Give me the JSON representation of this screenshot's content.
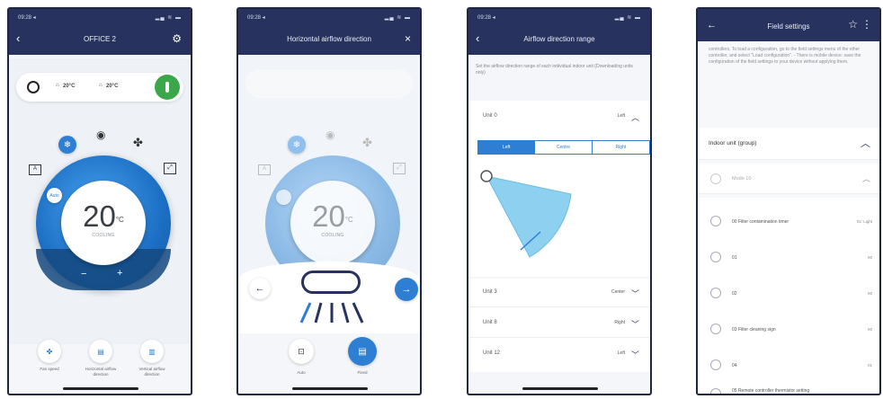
{
  "screen1": {
    "status_time": "09:28 ◂",
    "title": "OFFICE 2",
    "room_temp": "20°C",
    "outdoor_temp": "20°C",
    "set_temp": "20",
    "degree": "°C",
    "mode": "COOLING",
    "minus": "−",
    "plus": "+",
    "btn1_label": "Fan speed",
    "btn2_label": "Horizontal airflow direction",
    "btn3_label": "Vertical airflow direction",
    "fan_badge": "Auto"
  },
  "screen2": {
    "status_time": "09:28 ◂",
    "title": "Horizontal airflow direction",
    "close": "×",
    "set_temp": "20",
    "degree": "°C",
    "mode": "COOLING",
    "auto_label": "Auto",
    "fixed_label": "Fixed"
  },
  "screen3": {
    "status_time": "09:28 ◂",
    "title": "Airflow direction range",
    "description": "Set the airflow direction range of each individual indoor unit (Downloading units only)",
    "units": [
      {
        "name": "Unit 0",
        "value": "Left"
      },
      {
        "name": "Unit 3",
        "value": "Center"
      },
      {
        "name": "Unit 8",
        "value": "Right"
      },
      {
        "name": "Unit 12",
        "value": "Left"
      }
    ],
    "tabs": [
      "Left",
      "Centre",
      "Right"
    ],
    "active_tab": "Left"
  },
  "screen4": {
    "title": "Field settings",
    "intro": "controllers. To load a configuration, go to the field settings menu of the other controller, and select \"Load configuration\". - There is mobile device: save the configuration of the field settings to your device without applying them.",
    "group_header": "Indoor unit (group)",
    "mode": "Mode 10",
    "items": [
      {
        "label": "00 Filter contamination timer",
        "value": "01: Light"
      },
      {
        "label": "01",
        "value": "00"
      },
      {
        "label": "02",
        "value": "00"
      },
      {
        "label": "03 Filter cleaning sign",
        "value": "00"
      },
      {
        "label": "04",
        "value": "01"
      },
      {
        "label": "05 Remote controller thermistor setting",
        "value": ""
      }
    ]
  },
  "colors": {
    "navy": "#27335e",
    "blue": "#2e7fd3",
    "green": "#3aa84a"
  }
}
